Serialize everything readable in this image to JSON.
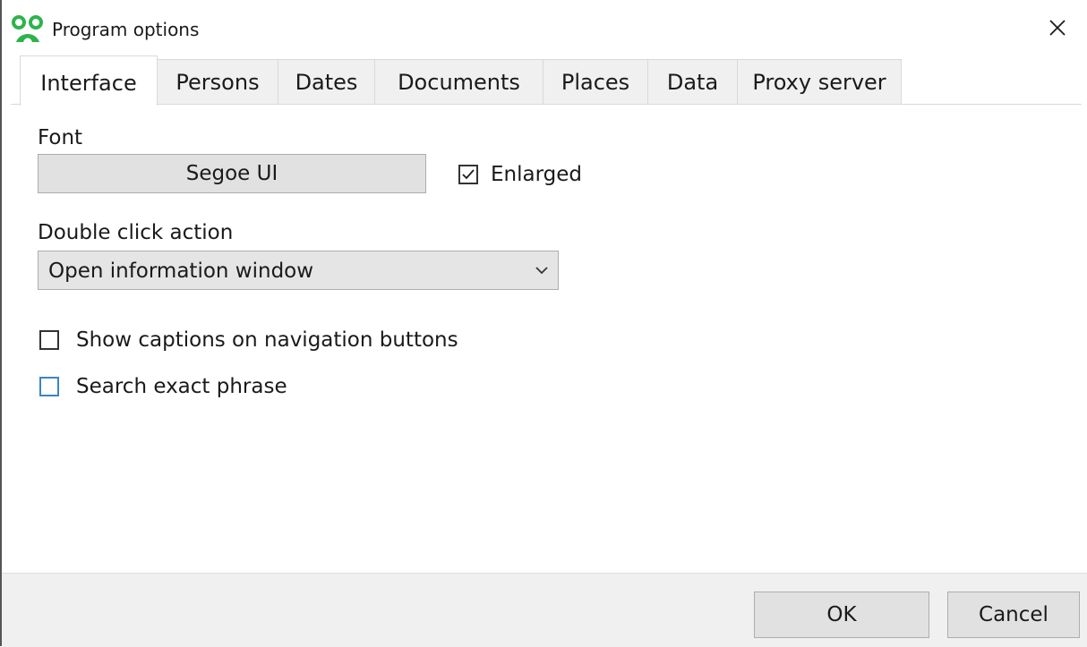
{
  "window": {
    "title": "Program options",
    "close_icon": "close-icon",
    "app_icon": "app-logo-icon"
  },
  "tabs": [
    {
      "label": "Interface",
      "active": true
    },
    {
      "label": "Persons",
      "active": false
    },
    {
      "label": "Dates",
      "active": false
    },
    {
      "label": "Documents",
      "active": false
    },
    {
      "label": "Places",
      "active": false
    },
    {
      "label": "Data",
      "active": false
    },
    {
      "label": "Proxy server",
      "active": false
    }
  ],
  "interface": {
    "font_label": "Font",
    "font_value": "Segoe UI",
    "enlarged_label": "Enlarged",
    "enlarged_checked": true,
    "double_click_label": "Double click action",
    "double_click_value": "Open information window",
    "show_captions_label": "Show captions on navigation buttons",
    "show_captions_checked": false,
    "search_exact_label": "Search exact phrase",
    "search_exact_checked": false
  },
  "footer": {
    "ok_label": "OK",
    "cancel_label": "Cancel"
  },
  "colors": {
    "app_icon_green": "#2db34a",
    "focus_blue": "#3c84c6"
  }
}
